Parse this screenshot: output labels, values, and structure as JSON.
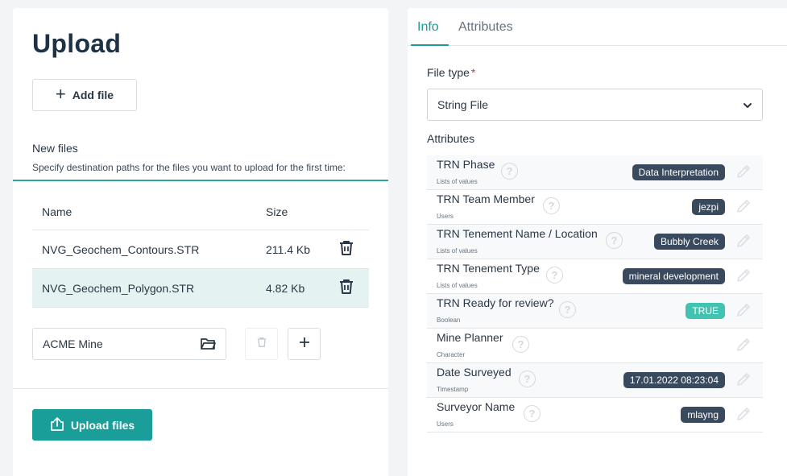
{
  "upload": {
    "title": "Upload",
    "add_file_label": "Add file",
    "new_files_heading": "New files",
    "new_files_hint": "Specify destination paths for the files you want to upload for the first time:",
    "table": {
      "col_name": "Name",
      "col_size": "Size",
      "rows": [
        {
          "name": "NVG_Geochem_Contours.STR",
          "size": "211.4 Kb",
          "selected": false
        },
        {
          "name": "NVG_Geochem_Polygon.STR",
          "size": "4.82 Kb",
          "selected": true
        }
      ]
    },
    "destination_value": "ACME Mine",
    "upload_button_label": "Upload files"
  },
  "details": {
    "tabs": [
      {
        "label": "Info",
        "active": true
      },
      {
        "label": "Attributes",
        "active": false
      }
    ],
    "file_type_label": "File type",
    "required_mark": "*",
    "file_type_value": "String File",
    "attributes_heading": "Attributes",
    "attributes": [
      {
        "name": "TRN Phase",
        "type": "Lists of values",
        "value": "Data Interpretation",
        "kind": "list"
      },
      {
        "name": "TRN Team Member",
        "type": "Users",
        "value": "jezpi",
        "kind": "list"
      },
      {
        "name": "TRN Tenement Name / Location",
        "type": "Lists of values",
        "value": "Bubbly Creek",
        "kind": "list"
      },
      {
        "name": "TRN Tenement Type",
        "type": "Lists of values",
        "value": "mineral development",
        "kind": "list"
      },
      {
        "name": "TRN Ready for review?",
        "type": "Boolean",
        "value": "TRUE",
        "kind": "bool"
      },
      {
        "name": "Mine Planner",
        "type": "Character",
        "value": "",
        "kind": "none"
      },
      {
        "name": "Date Surveyed",
        "type": "Timestamp",
        "value": "17.01.2022 08:23:04",
        "kind": "list"
      },
      {
        "name": "Surveyor Name",
        "type": "Users",
        "value": "mlayng",
        "kind": "list"
      }
    ]
  },
  "colors": {
    "accent": "#1a9e9a",
    "pill_dark": "#3a4a5e",
    "pill_bool": "#42c2b1",
    "selected_row": "#e4f3f2"
  }
}
